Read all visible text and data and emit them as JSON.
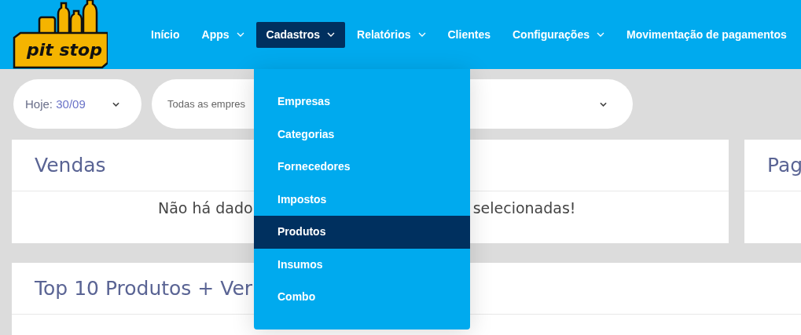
{
  "logo": {
    "text": "pit stop"
  },
  "nav": [
    {
      "label": "Início",
      "has_menu": false,
      "selected": false
    },
    {
      "label": "Apps",
      "has_menu": true,
      "selected": false
    },
    {
      "label": "Cadastros",
      "has_menu": true,
      "selected": true
    },
    {
      "label": "Relatórios",
      "has_menu": true,
      "selected": false
    },
    {
      "label": "Clientes",
      "has_menu": false,
      "selected": false
    },
    {
      "label": "Configurações",
      "has_menu": true,
      "selected": false
    },
    {
      "label": "Movimentação de pagamentos",
      "has_menu": false,
      "selected": false
    }
  ],
  "dropdown": {
    "items": [
      {
        "label": "Empresas",
        "selected": false
      },
      {
        "label": "Categorias",
        "selected": false
      },
      {
        "label": "Fornecedores",
        "selected": false
      },
      {
        "label": "Impostos",
        "selected": false
      },
      {
        "label": "Produtos",
        "selected": true
      },
      {
        "label": "Insumos",
        "selected": false
      },
      {
        "label": "Combo",
        "selected": false
      }
    ]
  },
  "filters": {
    "date": {
      "prefix": "Hoje:",
      "value": "30/09"
    },
    "company": {
      "value": "Todas as empres"
    }
  },
  "cards": [
    {
      "title": "Vendas",
      "message_start": "Não há dado",
      "message_end": "selecionadas!"
    },
    {
      "title": "Pag"
    },
    {
      "title": "Top 10 Produtos + Ver"
    }
  ]
}
